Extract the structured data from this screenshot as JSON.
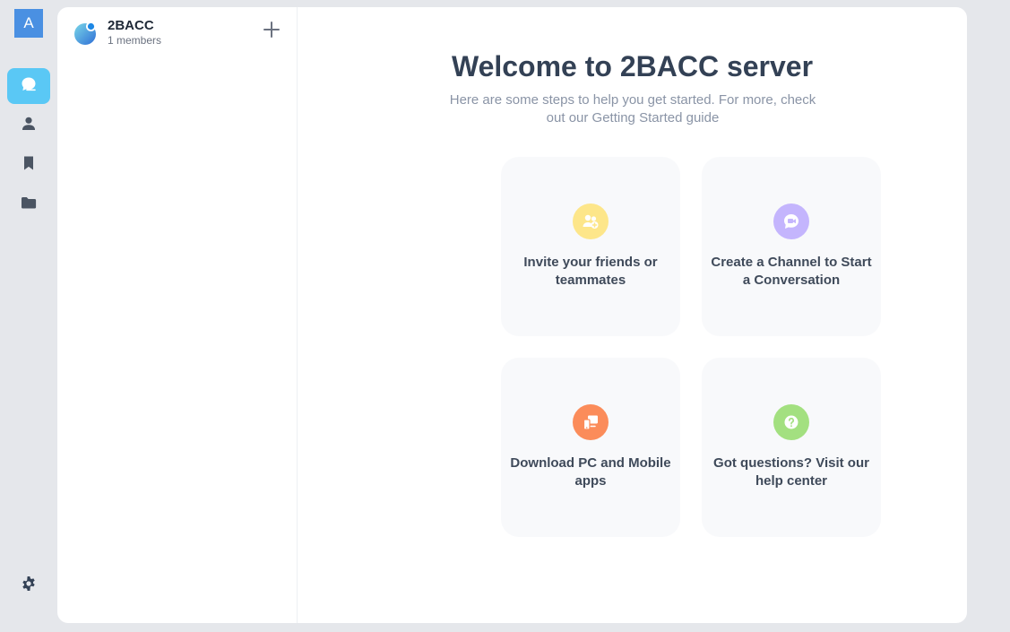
{
  "user": {
    "avatar_letter": "A"
  },
  "rail": {
    "items": [
      {
        "icon": "chat-icon",
        "active": true
      },
      {
        "icon": "contacts-icon",
        "active": false
      },
      {
        "icon": "bookmark-icon",
        "active": false
      },
      {
        "icon": "folder-icon",
        "active": false
      }
    ],
    "bottom_icon": "gear-icon"
  },
  "server": {
    "name": "2BACC",
    "members": "1 members"
  },
  "welcome": {
    "title": "Welcome to 2BACC server",
    "subtitle": "Here are some steps to help you get started. For more, check out our Getting Started guide"
  },
  "tiles": [
    {
      "label": "Invite your friends or teammates",
      "icon": "invite-friends-icon",
      "color": "#fde68a"
    },
    {
      "label": "Create a Channel to Start a Conversation",
      "icon": "create-channel-icon",
      "color": "#c4b5fd"
    },
    {
      "label": "Download PC and Mobile apps",
      "icon": "download-apps-icon",
      "color": "#fb8c5a"
    },
    {
      "label": "Got questions? Visit our help center",
      "icon": "help-center-icon",
      "color": "#a3e080"
    }
  ],
  "colors": {
    "accent": "#5ac8f5",
    "avatar": "#4a90e2",
    "background": "#e5e7eb"
  }
}
